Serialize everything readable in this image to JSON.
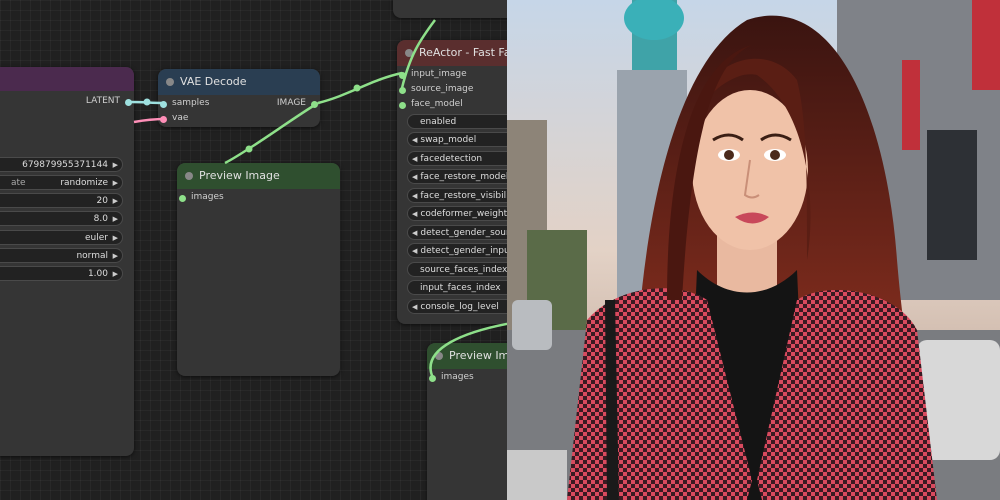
{
  "colors": {
    "wire": "#8ee08a",
    "pin_latent": "#9ee0df",
    "pin_image": "#8ee08a",
    "pin_vae": "#ff8fb8",
    "header_vae_decode": "#2a3e52",
    "header_preview": "#2f4f2f",
    "header_reactor": "#5a2e2e",
    "header_ksampler": "#4b2a4e"
  },
  "ksampler": {
    "output_label": "LATENT",
    "widgets": [
      {
        "label": "",
        "value": "679879955371144"
      },
      {
        "label": "ate",
        "value": "randomize"
      },
      {
        "label": "",
        "value": "20"
      },
      {
        "label": "",
        "value": "8.0"
      },
      {
        "label": "",
        "value": "euler"
      },
      {
        "label": "",
        "value": "normal"
      },
      {
        "label": "",
        "value": "1.00"
      }
    ]
  },
  "vae_decode": {
    "title": "VAE Decode",
    "inputs": [
      "samples",
      "vae"
    ],
    "output": "IMAGE"
  },
  "preview1": {
    "title": "Preview Image",
    "input": "images"
  },
  "reactor": {
    "title": "ReActor - Fast Fa",
    "inputs": [
      "input_image",
      "source_image",
      "face_model"
    ],
    "widgets": [
      "enabled",
      "swap_model",
      "facedetection",
      "face_restore_model",
      "face_restore_visibili",
      "codeformer_weight",
      "detect_gender_sour",
      "detect_gender_inpu",
      "source_faces_index",
      "input_faces_index",
      "console_log_level"
    ]
  },
  "preview2": {
    "title": "Preview Ima",
    "input": "images"
  },
  "photo": {
    "subject": "portrait-woman-houndstooth-blazer-city-street"
  }
}
